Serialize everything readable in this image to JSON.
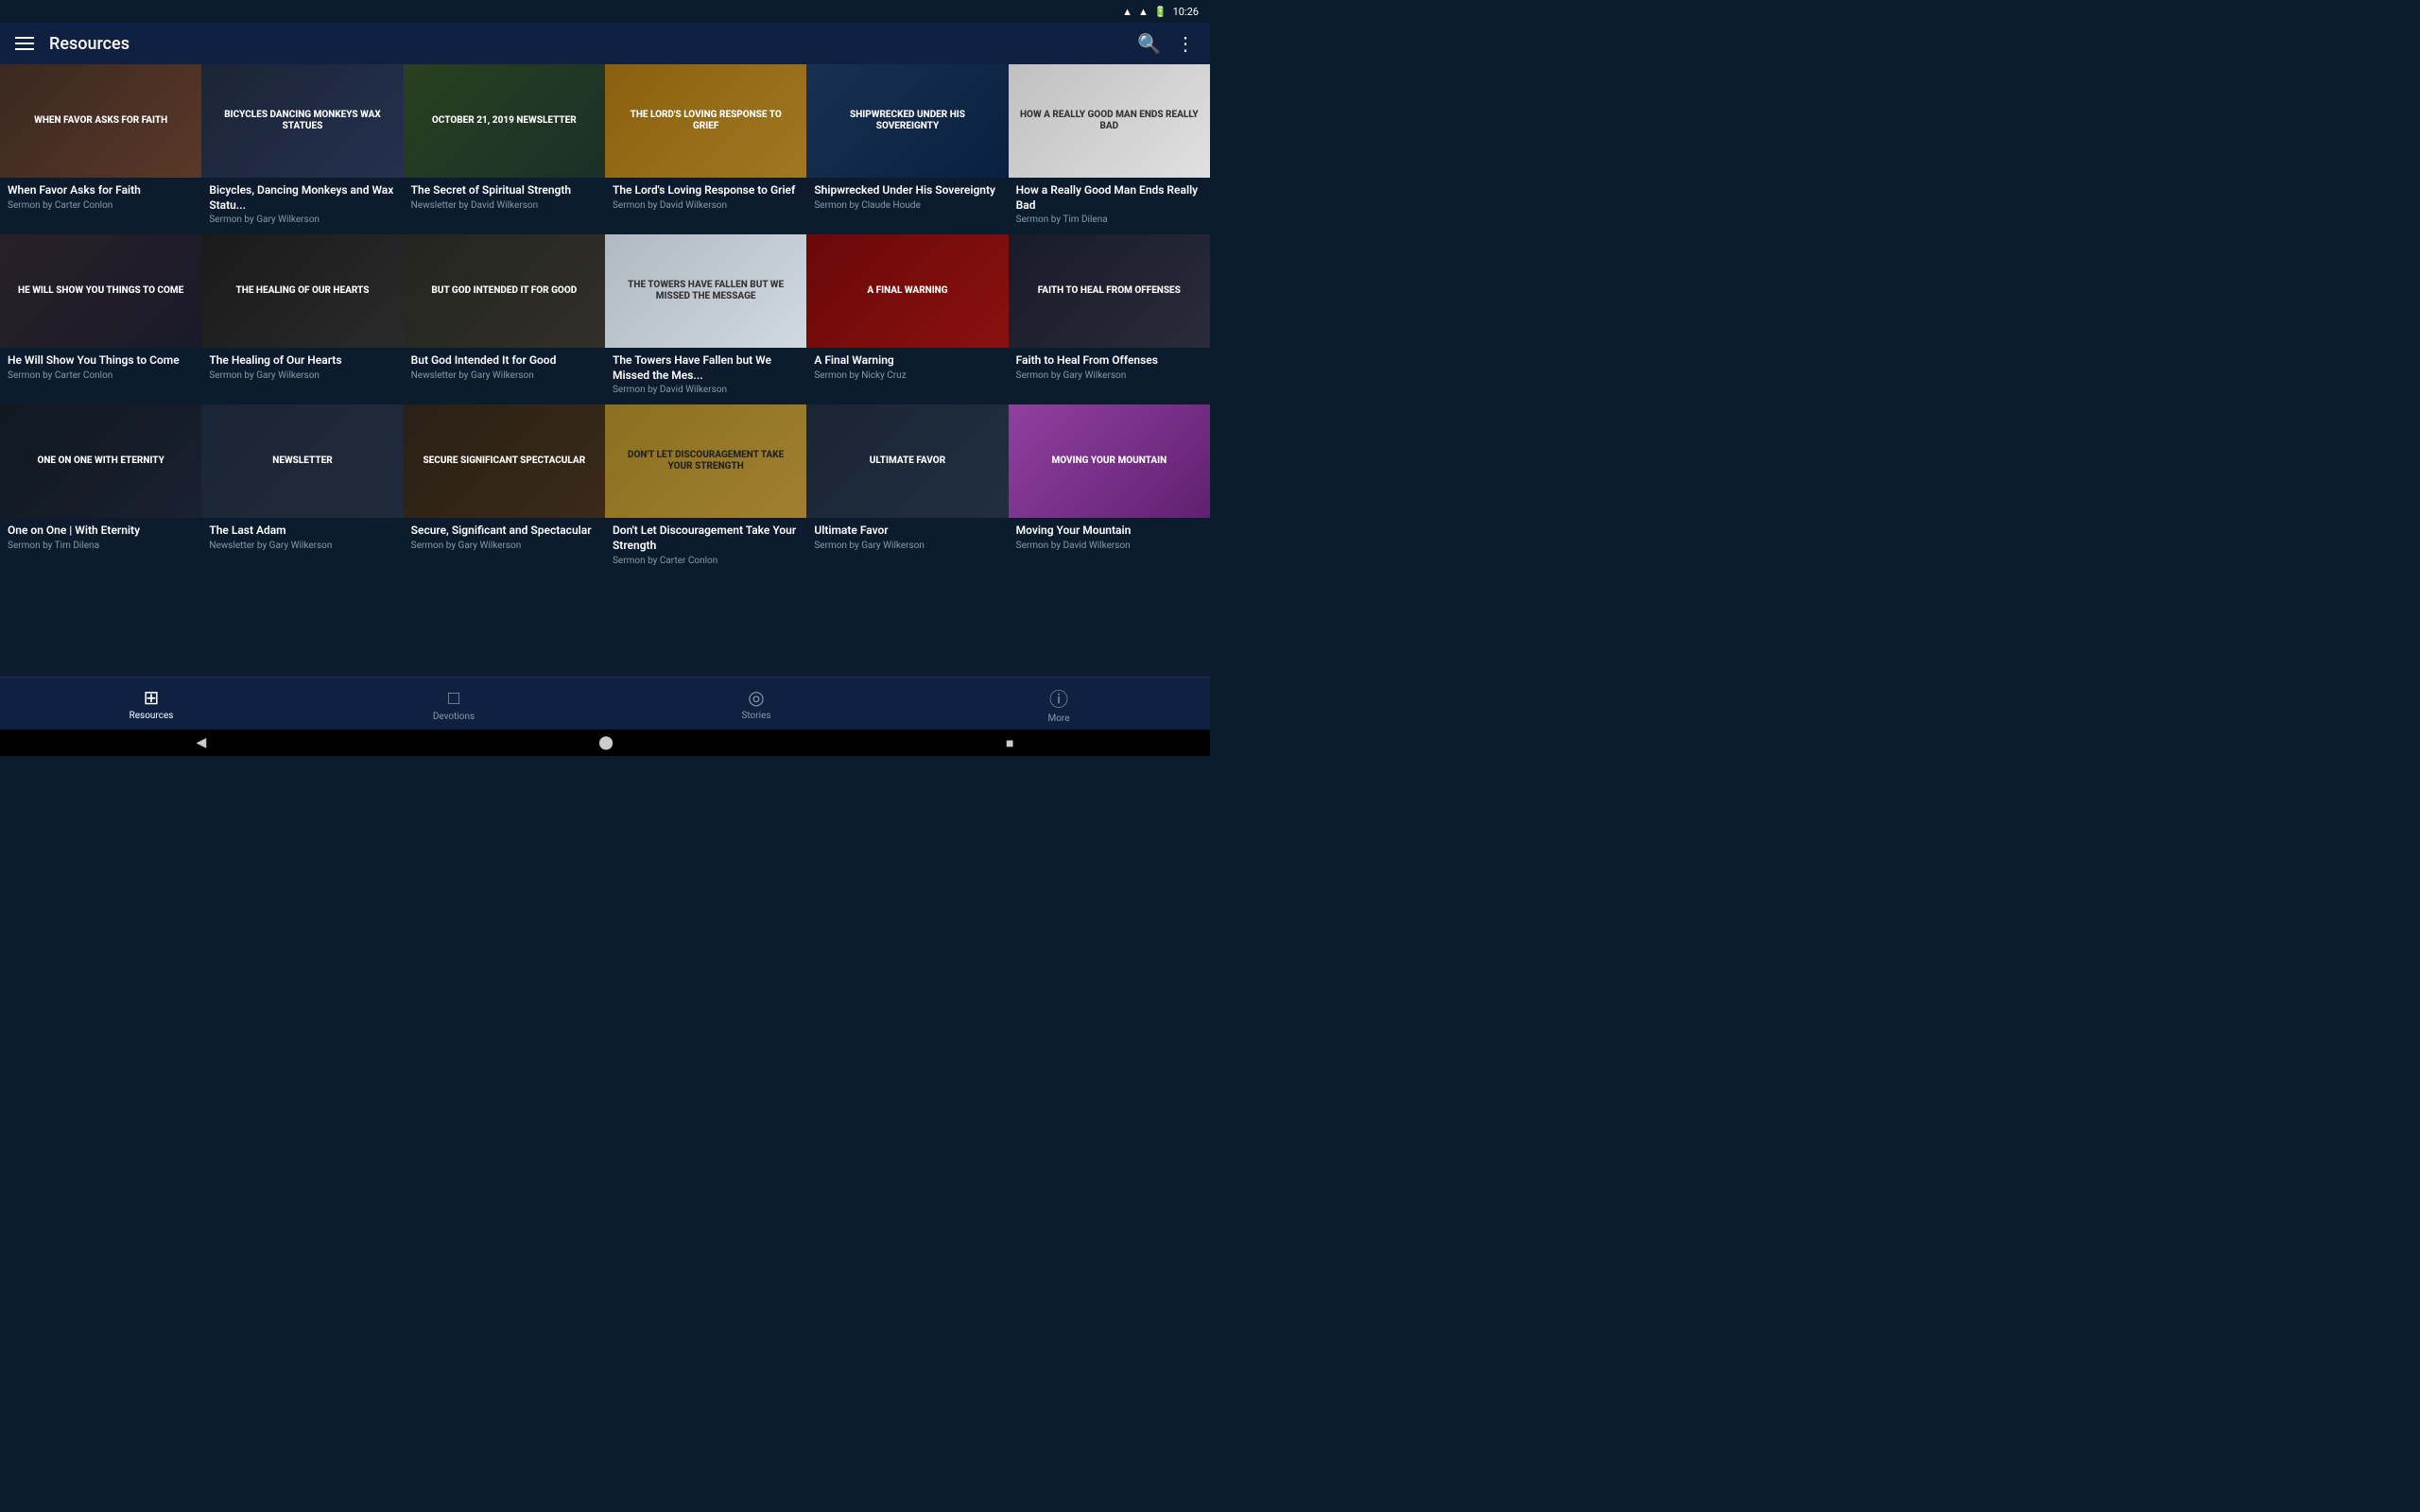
{
  "statusBar": {
    "time": "10:26",
    "wifi": "wifi",
    "signal": "signal",
    "battery": "battery"
  },
  "topNav": {
    "title": "Resources",
    "searchLabel": "search",
    "moreLabel": "more"
  },
  "grid": {
    "items": [
      {
        "id": 1,
        "title": "When Favor Asks for Faith",
        "subtitle": "Sermon by Carter Conlon",
        "thumbText": "WHEN FAVOR ASKS\nFOR FAITH",
        "thumbClass": "thumb-for-faith"
      },
      {
        "id": 2,
        "title": "Bicycles, Dancing Monkeys and Wax Statu...",
        "subtitle": "Sermon by Gary Wilkerson",
        "thumbText": "BICYCLES\nDANCING MONKEYS\nWAX STATUES",
        "thumbClass": "thumb-bicycles"
      },
      {
        "id": 3,
        "title": "The Secret of Spiritual Strength",
        "subtitle": "Newsletter by David Wilkerson",
        "thumbText": "OCTOBER 21, 2019\nNEWSLETTER",
        "thumbClass": "thumb-newsletter"
      },
      {
        "id": 4,
        "title": "The Lord's Loving Response to Grief",
        "subtitle": "Sermon by David Wilkerson",
        "thumbText": "THE LORD'S LOVING\nRESPONSE TO GRIEF",
        "thumbClass": "thumb-lords"
      },
      {
        "id": 5,
        "title": "Shipwrecked Under His Sovereignty",
        "subtitle": "Sermon by Claude Houde",
        "thumbText": "SHIPWRECKED\nUNDER HIS SOVEREIGNTY",
        "thumbClass": "thumb-shipwrecked"
      },
      {
        "id": 6,
        "title": "How a Really Good Man Ends Really Bad",
        "subtitle": "Sermon by Tim Dilena",
        "thumbText": "HOW A REALLY\nGOOD MAN\nENDS REALLY BAD",
        "thumbClass": "thumb-goodman"
      },
      {
        "id": 7,
        "title": "He Will Show You Things to Come",
        "subtitle": "Sermon by Carter Conlon",
        "thumbText": "HE WILL SHOW YOU\nTHINGS TO COME",
        "thumbClass": "thumb-show"
      },
      {
        "id": 8,
        "title": "The Healing of Our Hearts",
        "subtitle": "Sermon by Gary Wilkerson",
        "thumbText": "THE HEALING\nOF OUR HEARTS",
        "thumbClass": "thumb-healing"
      },
      {
        "id": 9,
        "title": "But God Intended It for Good",
        "subtitle": "Newsletter by Gary Wilkerson",
        "thumbText": "BUT GOD\nINTENDED IT\nFOR GOOD",
        "thumbClass": "thumb-butgod"
      },
      {
        "id": 10,
        "title": "The Towers Have Fallen but We Missed the Mes...",
        "subtitle": "Sermon by David Wilkerson",
        "thumbText": "THE TOWERS HAVE FALLEN\nBUT WE MISSED\nTHE MESSAGE",
        "thumbClass": "thumb-towers"
      },
      {
        "id": 11,
        "title": "A Final Warning",
        "subtitle": "Sermon by Nicky Cruz",
        "thumbText": "A FINAL WARNING",
        "thumbClass": "thumb-warning"
      },
      {
        "id": 12,
        "title": "Faith to Heal From Offenses",
        "subtitle": "Sermon by Gary Wilkerson",
        "thumbText": "FAITH TO HEAL\nFROM OFFENSES",
        "thumbClass": "thumb-faith-heal"
      },
      {
        "id": 13,
        "title": "One on One | With Eternity",
        "subtitle": "Sermon by Tim Dilena",
        "thumbText": "ONE ON ONE\nWITH ETERNITY",
        "thumbClass": "thumb-one"
      },
      {
        "id": 14,
        "title": "The Last Adam",
        "subtitle": "Newsletter by Gary Wilkerson",
        "thumbText": "NEWSLETTER",
        "thumbClass": "thumb-lastadam"
      },
      {
        "id": 15,
        "title": "Secure, Significant and Spectacular",
        "subtitle": "Sermon by Gary Wilkerson",
        "thumbText": "SECURE\nSIGNIFICANT\nSPECTACULAR",
        "thumbClass": "thumb-secure"
      },
      {
        "id": 16,
        "title": "Don't Let Discouragement Take Your Strength",
        "subtitle": "Sermon by Carter Conlon",
        "thumbText": "DON'T LET DISCOURAGEMENT\nTAKE YOUR STRENGTH",
        "thumbClass": "thumb-discour"
      },
      {
        "id": 17,
        "title": "Ultimate Favor",
        "subtitle": "Sermon by Gary Wilkerson",
        "thumbText": "ULTIMATE\nFAVOR",
        "thumbClass": "thumb-ultimate"
      },
      {
        "id": 18,
        "title": "Moving Your Mountain",
        "subtitle": "Sermon by David Wilkerson",
        "thumbText": "MOVING YOUR\nMOUNTAIN",
        "thumbClass": "thumb-mountain"
      }
    ]
  },
  "bottomNav": {
    "items": [
      {
        "id": "resources",
        "label": "Resources",
        "icon": "⊞",
        "active": true
      },
      {
        "id": "devotions",
        "label": "Devotions",
        "icon": "📖",
        "active": false
      },
      {
        "id": "stories",
        "label": "Stories",
        "icon": "💬",
        "active": false
      },
      {
        "id": "more",
        "label": "More",
        "icon": "ℹ",
        "active": false
      }
    ]
  },
  "androidNav": {
    "back": "◀",
    "home": "⬤",
    "recent": "■"
  }
}
